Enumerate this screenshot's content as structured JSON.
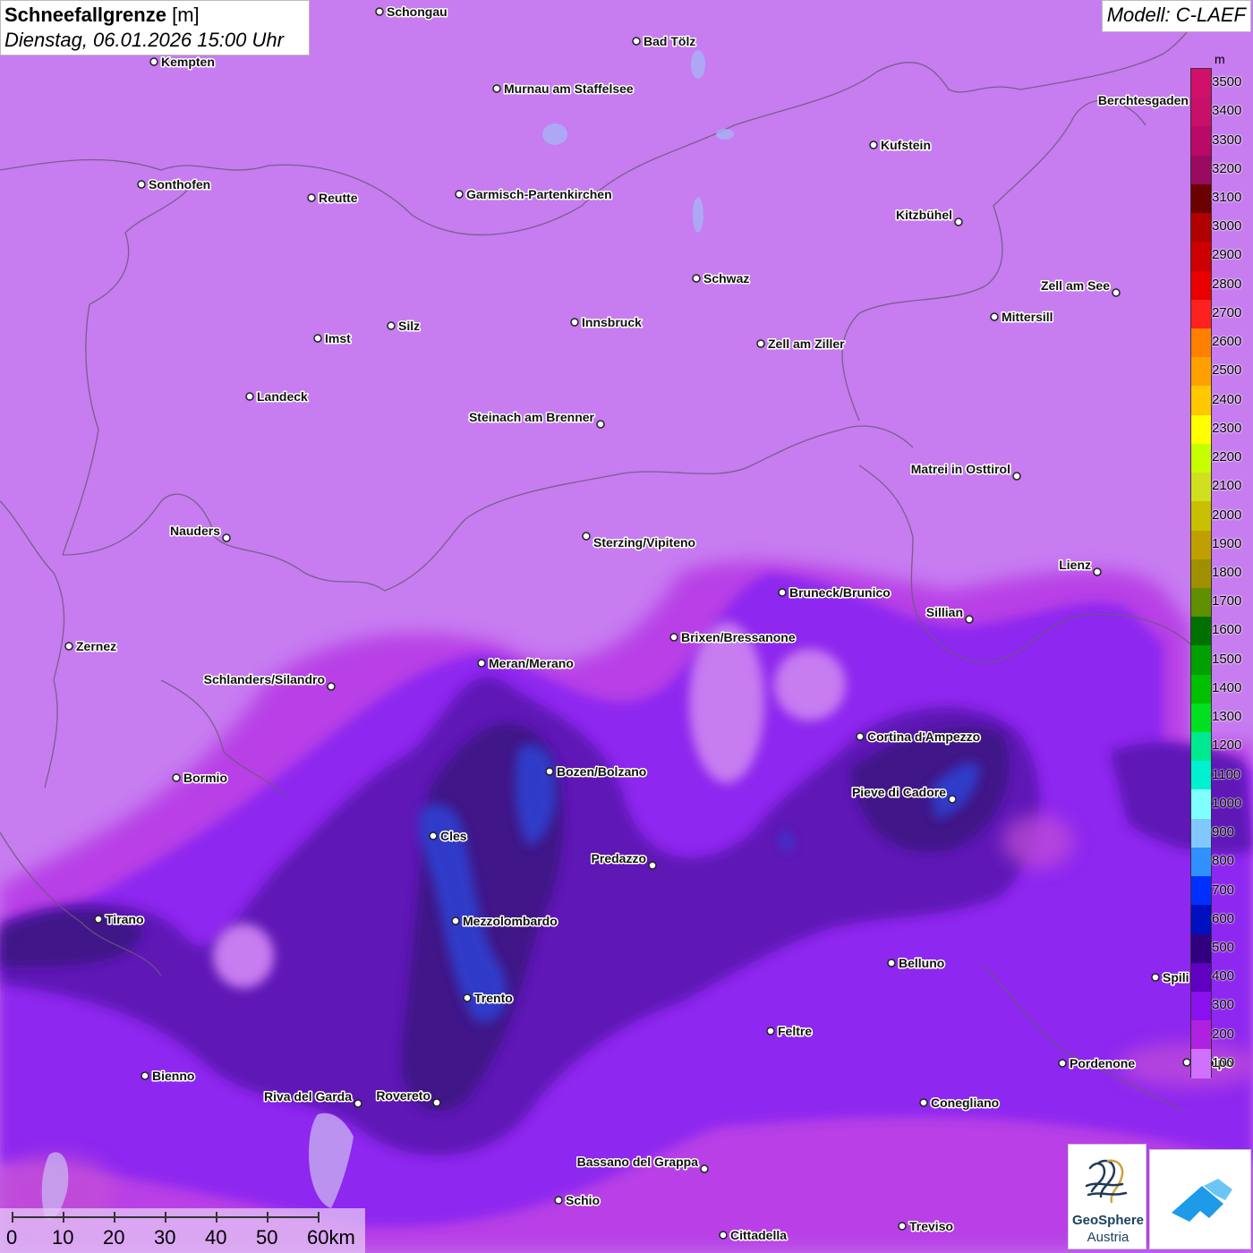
{
  "header": {
    "title": "Schneefallgrenze",
    "unit": "[m]",
    "datetime": "Dienstag, 06.01.2026 15:00 Uhr",
    "model": "Modell: C-LAEF"
  },
  "legend": {
    "unit": "m",
    "steps": [
      {
        "label": "3500",
        "color": "#d0106a"
      },
      {
        "label": "3400",
        "color": "#c8106a"
      },
      {
        "label": "3300",
        "color": "#b80a66"
      },
      {
        "label": "3200",
        "color": "#9a0a60"
      },
      {
        "label": "3100",
        "color": "#6a0000"
      },
      {
        "label": "3000",
        "color": "#b00000"
      },
      {
        "label": "2900",
        "color": "#cc0000"
      },
      {
        "label": "2800",
        "color": "#e80000"
      },
      {
        "label": "2700",
        "color": "#ff2020"
      },
      {
        "label": "2600",
        "color": "#ff8000"
      },
      {
        "label": "2500",
        "color": "#ffa000"
      },
      {
        "label": "2400",
        "color": "#ffc800"
      },
      {
        "label": "2300",
        "color": "#ffff00"
      },
      {
        "label": "2200",
        "color": "#c8ff00"
      },
      {
        "label": "2100",
        "color": "#d0e020"
      },
      {
        "label": "2000",
        "color": "#c8c000"
      },
      {
        "label": "1900",
        "color": "#c0a000"
      },
      {
        "label": "1800",
        "color": "#a09000"
      },
      {
        "label": "1700",
        "color": "#609000"
      },
      {
        "label": "1600",
        "color": "#007000"
      },
      {
        "label": "1500",
        "color": "#00a000"
      },
      {
        "label": "1400",
        "color": "#00c000"
      },
      {
        "label": "1300",
        "color": "#00e020"
      },
      {
        "label": "1200",
        "color": "#00e890"
      },
      {
        "label": "1100",
        "color": "#00f0d0"
      },
      {
        "label": "1000",
        "color": "#80ffff"
      },
      {
        "label": "900",
        "color": "#80c8ff"
      },
      {
        "label": "800",
        "color": "#3090ff"
      },
      {
        "label": "700",
        "color": "#0030ff"
      },
      {
        "label": "600",
        "color": "#0010c0"
      },
      {
        "label": "500",
        "color": "#300080"
      },
      {
        "label": "400",
        "color": "#6000c0"
      },
      {
        "label": "300",
        "color": "#8a10f0"
      },
      {
        "label": "200",
        "color": "#b020e0"
      },
      {
        "label": "100",
        "color": "#d070ff"
      }
    ]
  },
  "cities": [
    {
      "name": "Schongau"
    },
    {
      "name": "Bad Tölz"
    },
    {
      "name": "Kempten"
    },
    {
      "name": "Murnau am Staffelsee"
    },
    {
      "name": "Berchtesgaden"
    },
    {
      "name": "Kufstein"
    },
    {
      "name": "Sonthofen"
    },
    {
      "name": "Reutte"
    },
    {
      "name": "Garmisch-Partenkirchen"
    },
    {
      "name": "Kitzbühel"
    },
    {
      "name": "Schwaz"
    },
    {
      "name": "Zell am See"
    },
    {
      "name": "Innsbruck"
    },
    {
      "name": "Silz"
    },
    {
      "name": "Imst"
    },
    {
      "name": "Mittersill"
    },
    {
      "name": "Zell am Ziller"
    },
    {
      "name": "Landeck"
    },
    {
      "name": "Steinach am Brenner"
    },
    {
      "name": "Matrei in Osttirol"
    },
    {
      "name": "Nauders"
    },
    {
      "name": "Sterzing/Vipiteno"
    },
    {
      "name": "Lienz"
    },
    {
      "name": "Bruneck/Brunico"
    },
    {
      "name": "Sillian"
    },
    {
      "name": "Zernez"
    },
    {
      "name": "Brixen/Bressanone"
    },
    {
      "name": "Meran/Merano"
    },
    {
      "name": "Schlanders/Silandro"
    },
    {
      "name": "Cortina d'Ampezzo"
    },
    {
      "name": "Bormio"
    },
    {
      "name": "Bozen/Bolzano"
    },
    {
      "name": "Pieve di Cadore"
    },
    {
      "name": "Cles"
    },
    {
      "name": "Predazzo"
    },
    {
      "name": "Tirano"
    },
    {
      "name": "Mezzolombardo"
    },
    {
      "name": "Belluno"
    },
    {
      "name": "Spili"
    },
    {
      "name": "Trento"
    },
    {
      "name": "Feltre"
    },
    {
      "name": "Pordenone"
    },
    {
      "name": "droipo"
    },
    {
      "name": "Bienno"
    },
    {
      "name": "Riva del Garda"
    },
    {
      "name": "Rovereto"
    },
    {
      "name": "Conegliano"
    },
    {
      "name": "Bassano del Grappa"
    },
    {
      "name": "Schio"
    },
    {
      "name": "Treviso"
    },
    {
      "name": "Cittadella"
    }
  ],
  "scalebar": {
    "ticks": [
      "0",
      "10",
      "20",
      "30",
      "40",
      "50",
      "60km"
    ]
  },
  "logo": {
    "line1": "GeoSphere",
    "line2": "Austria"
  }
}
